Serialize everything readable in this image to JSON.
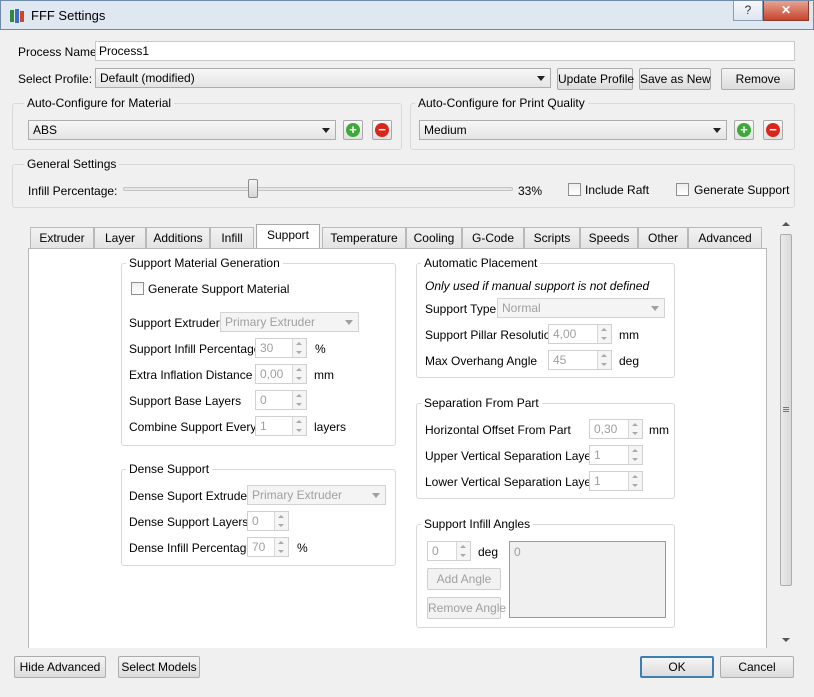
{
  "window": {
    "title": "FFF Settings",
    "help_label": "?",
    "minimize_label": "—",
    "close_label": "✕"
  },
  "process": {
    "name_label": "Process Name:",
    "name_value": "Process1"
  },
  "profile": {
    "label": "Select Profile:",
    "value": "Default (modified)",
    "update_label": "Update Profile",
    "save_label": "Save as New",
    "remove_label": "Remove"
  },
  "material": {
    "title": "Auto-Configure for Material",
    "value": "ABS"
  },
  "quality": {
    "title": "Auto-Configure for Print Quality",
    "value": "Medium"
  },
  "general": {
    "title": "General Settings",
    "infill_label": "Infill Percentage:",
    "infill_value": "33%",
    "infill_fraction": 0.33,
    "raft_label": "Include Raft",
    "support_label": "Generate Support"
  },
  "tabs": [
    "Extruder",
    "Layer",
    "Additions",
    "Infill",
    "Support",
    "Temperature",
    "Cooling",
    "G-Code",
    "Scripts",
    "Speeds",
    "Other",
    "Advanced"
  ],
  "active_tab": "Support",
  "support_material": {
    "title": "Support Material Generation",
    "generate_label": "Generate Support Material",
    "extruder_label": "Support Extruder",
    "extruder_value": "Primary Extruder",
    "infill_label": "Support Infill Percentage",
    "infill_value": "30",
    "infill_unit": "%",
    "inflation_label": "Extra Inflation Distance",
    "inflation_value": "0,00",
    "inflation_unit": "mm",
    "base_label": "Support Base Layers",
    "base_value": "0",
    "combine_label": "Combine Support Every",
    "combine_value": "1",
    "combine_unit": "layers"
  },
  "dense_support": {
    "title": "Dense Support",
    "extruder_label": "Dense Suport Extruder",
    "extruder_value": "Primary Extruder",
    "layers_label": "Dense Support Layers",
    "layers_value": "0",
    "infill_label": "Dense Infill Percentage",
    "infill_value": "70",
    "infill_unit": "%"
  },
  "auto_placement": {
    "title": "Automatic Placement",
    "note": "Only used if manual support is not defined",
    "type_label": "Support Type",
    "type_value": "Normal",
    "pillar_label": "Support Pillar Resolution",
    "pillar_value": "4,00",
    "pillar_unit": "mm",
    "overhang_label": "Max Overhang Angle",
    "overhang_value": "45",
    "overhang_unit": "deg"
  },
  "separation": {
    "title": "Separation From Part",
    "horizontal_label": "Horizontal Offset From Part",
    "horizontal_value": "0,30",
    "horizontal_unit": "mm",
    "upper_label": "Upper Vertical Separation Layers",
    "upper_value": "1",
    "lower_label": "Lower Vertical Separation Layers",
    "lower_value": "1"
  },
  "infill_angles": {
    "title": "Support Infill Angles",
    "angle_value": "0",
    "angle_unit": "deg",
    "add_label": "Add Angle",
    "remove_label": "Remove Angle",
    "list": [
      "0"
    ]
  },
  "footer": {
    "hide_label": "Hide Advanced",
    "select_label": "Select Models",
    "ok_label": "OK",
    "cancel_label": "Cancel"
  },
  "colors": {
    "plus": "#3ea83a",
    "minus": "#d9261c",
    "accent": "#3c7fb1"
  }
}
